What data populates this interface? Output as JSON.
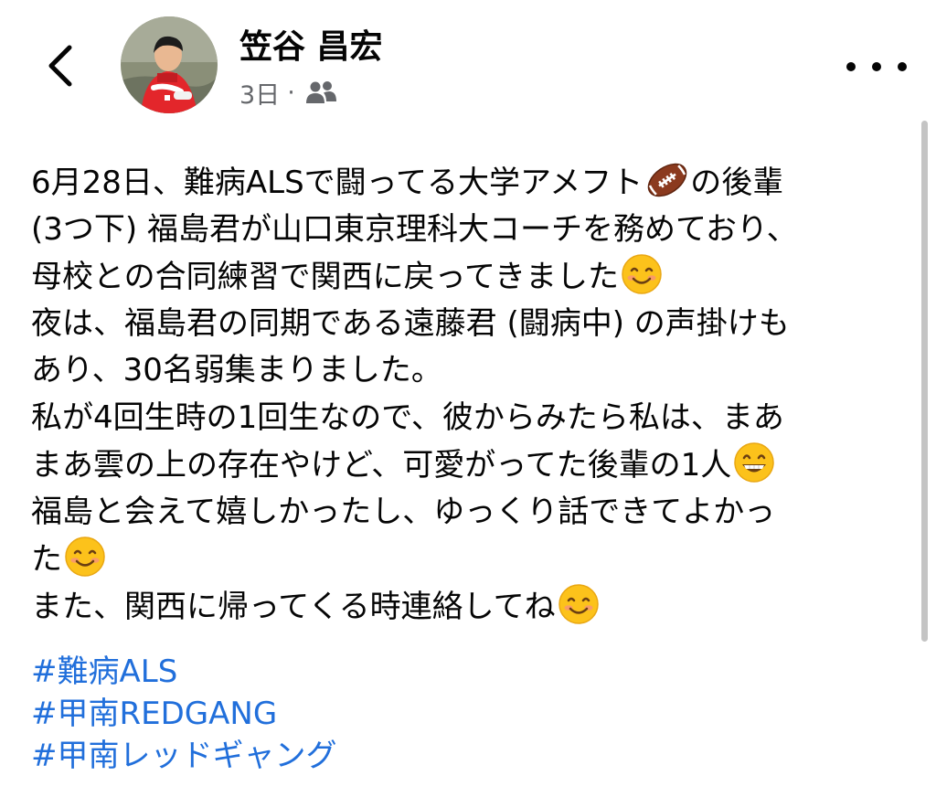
{
  "header": {
    "author_name": "笠谷 昌宏",
    "time_ago": "3日",
    "separator": "·",
    "audience_icon": "friends-icon",
    "back_icon": "chevron-left-icon",
    "more_icon": "more-options-icon",
    "avatar_description": "profile photo"
  },
  "post": {
    "lines": [
      {
        "text": "6月28日、難病ALSで闘ってる大学アメフト",
        "emoji": "american-football",
        "after": "の後輩"
      },
      {
        "text": "(3つ下) 福島君が山口東京理科大コーチを務めており、",
        "emoji": null,
        "after": ""
      },
      {
        "text": "母校との合同練習で関西に戻ってきました",
        "emoji": "smiling-face",
        "after": ""
      },
      {
        "text": "夜は、福島君の同期である遠藤君 (闘病中) の声掛けも",
        "emoji": null,
        "after": ""
      },
      {
        "text": "あり、30名弱集まりました。",
        "emoji": null,
        "after": ""
      },
      {
        "text": "私が4回生時の1回生なので、彼からみたら私は、まあ",
        "emoji": null,
        "after": ""
      },
      {
        "text": "まあ雲の上の存在やけど、可愛がってた後輩の1人",
        "emoji": "grinning-face",
        "after": ""
      },
      {
        "text": "福島と会えて嬉しかったし、ゆっくり話できてよかっ",
        "emoji": null,
        "after": ""
      },
      {
        "text": "た",
        "emoji": "smiling-face",
        "after": ""
      },
      {
        "text": "また、関西に帰ってくる時連絡してね",
        "emoji": "smiling-face",
        "after": ""
      }
    ],
    "hashtags": [
      "#難病ALS",
      "#甲南REDGANG",
      "#甲南レッドギャング"
    ]
  },
  "colors": {
    "text": "#050505",
    "meta": "#65676b",
    "hashtag": "#216fdb",
    "jersey_red": "#e3262b"
  }
}
